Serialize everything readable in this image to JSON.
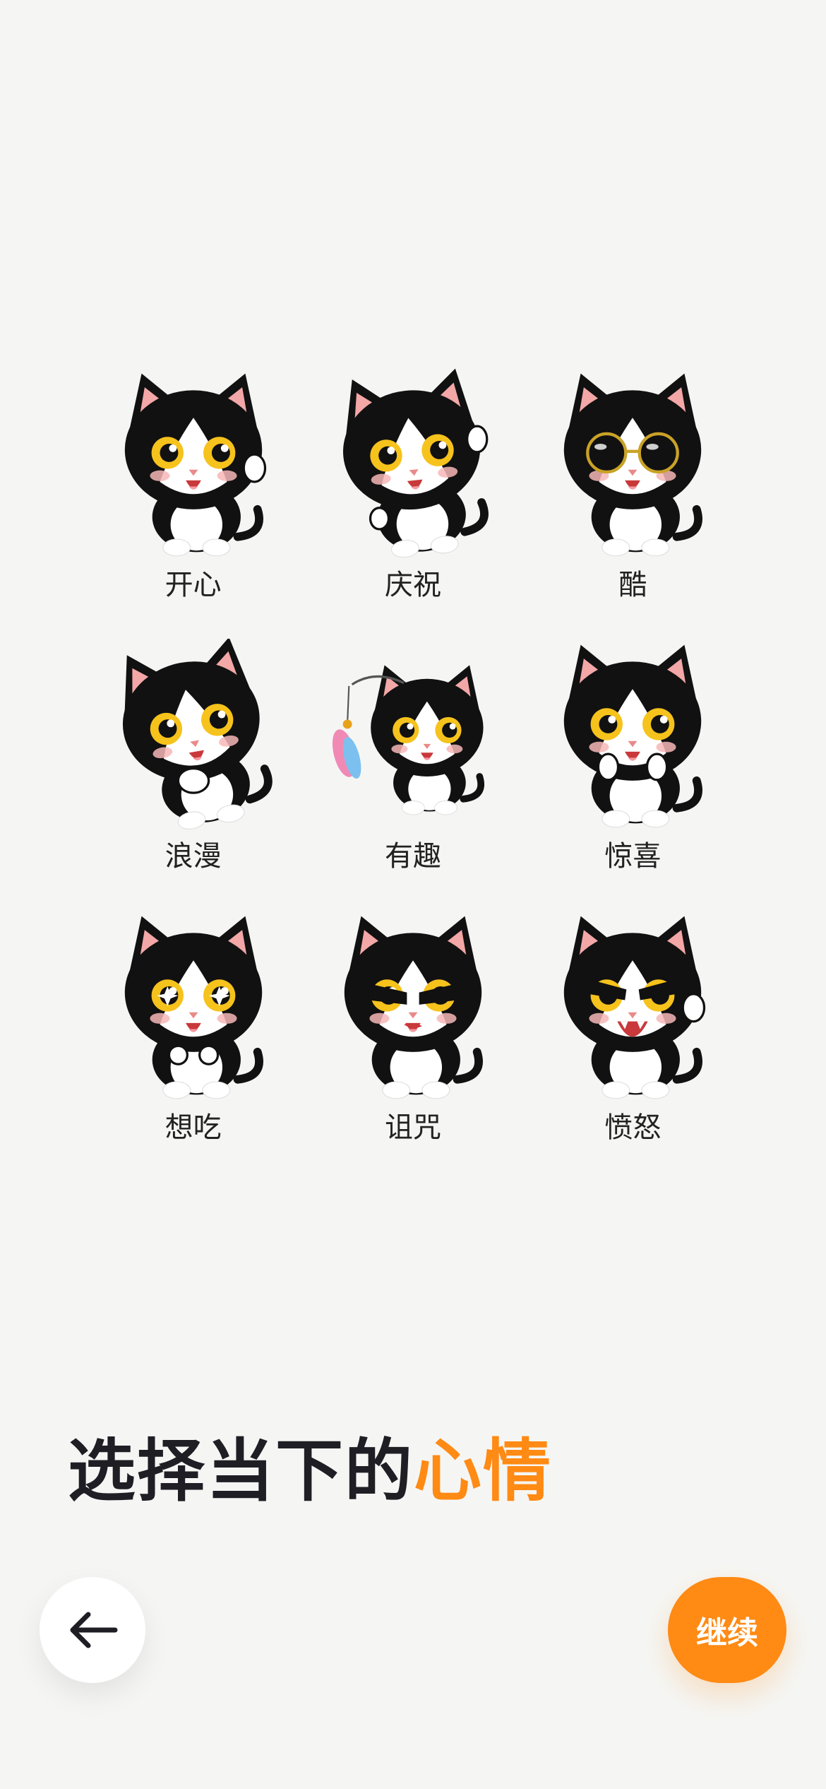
{
  "moods": [
    {
      "label": "开心",
      "icon": "happy-cat-icon"
    },
    {
      "label": "庆祝",
      "icon": "celebrating-cat-icon"
    },
    {
      "label": "酷",
      "icon": "cool-cat-sunglasses-icon"
    },
    {
      "label": "浪漫",
      "icon": "romantic-cat-icon"
    },
    {
      "label": "有趣",
      "icon": "playful-cat-feather-icon"
    },
    {
      "label": "惊喜",
      "icon": "surprised-cat-icon"
    },
    {
      "label": "想吃",
      "icon": "hungry-cat-icon"
    },
    {
      "label": "诅咒",
      "icon": "cursing-cat-icon"
    },
    {
      "label": "愤怒",
      "icon": "angry-cat-icon"
    }
  ],
  "title": {
    "prefix": "选择当下的",
    "accent": "心情"
  },
  "buttons": {
    "back_icon": "arrow-left-icon",
    "continue_label": "继续"
  },
  "colors": {
    "background": "#f5f6f4",
    "accent": "#ff8a14",
    "title": "#1e1e24",
    "button_light": "#ffffff"
  }
}
